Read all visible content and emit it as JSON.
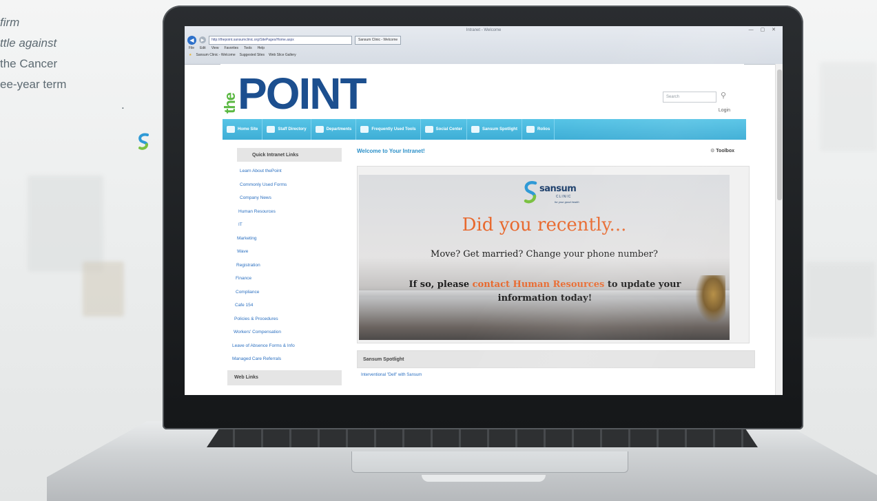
{
  "side_text": {
    "line1": "firm",
    "line2": "ttle against",
    "line3": "the Cancer",
    "line4": "ee-year term",
    "line5": "."
  },
  "browser": {
    "window_title": "Intranet - Welcome",
    "address": "http://thepoint.sansumclinic.org/SitePages/Home.aspx",
    "tab_label": "Sansum Clinic - Welcome",
    "menu": [
      "File",
      "Edit",
      "View",
      "Favorites",
      "Tools",
      "Help"
    ],
    "favorites": [
      "Sansum Clinic - Welcome",
      "Suggested Sites",
      "Web Slice Gallery"
    ]
  },
  "header": {
    "logo_the": "the",
    "logo_point": "POINT",
    "search_placeholder": "Search",
    "login": "Login"
  },
  "nav": [
    {
      "label": "Home Site"
    },
    {
      "label": "Staff Directory"
    },
    {
      "label": "Departments"
    },
    {
      "label": "Frequently Used Tools"
    },
    {
      "label": "Social Center"
    },
    {
      "label": "Sansum Spotlight"
    },
    {
      "label": "Rolios"
    }
  ],
  "sidebar": {
    "heading": "Quick Intranet Links",
    "links": [
      "Learn About thePoint",
      "Commonly Used Forms",
      "Company News",
      "Human Resources",
      "IT",
      "Marketing",
      "Wave",
      "Registration",
      "Finance",
      "Compliance",
      "Cafe 154",
      "Policies & Procedures",
      "Workers' Compensation",
      "Leave of Absence Forms & Info",
      "Managed Care Referrals"
    ],
    "heading2": "Web Links"
  },
  "main": {
    "welcome": "Welcome to Your Intranet!",
    "toolbox": "Toolbox",
    "banner": {
      "clinic_name": "sansum",
      "clinic_sub": "CLINIC",
      "clinic_tag": "for your good health",
      "headline": "Did you recently...",
      "line1": "Move? Get married? Change your phone number?",
      "line2_pre": "If so, please ",
      "line2_link": "contact Human Resources",
      "line2_post": " to update your information today!"
    },
    "spotlight_heading": "Sansum Spotlight",
    "spotlight_link": "Interventional \"Dell\" with Sansum"
  },
  "colors": {
    "brand_green": "#5bb842",
    "brand_blue": "#1c4f8f",
    "nav_bg": "#3eaed6",
    "link": "#2a6fc0",
    "accent_orange": "#e8692e"
  }
}
